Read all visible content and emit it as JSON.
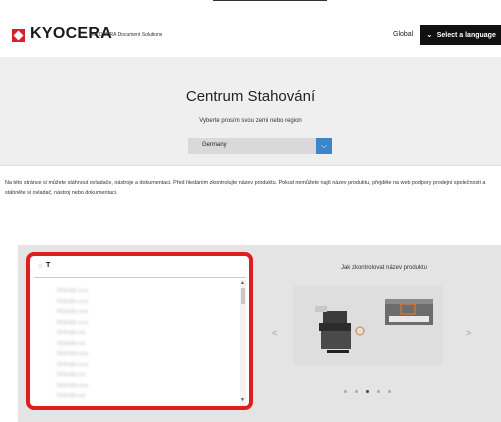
{
  "header": {
    "logo_text": "KYOCERA",
    "logo_subtitle": "KYOCERA Document Solutions",
    "global_label": "Global",
    "language_button": "Select a language"
  },
  "hero": {
    "title": "Centrum Stahování",
    "subtitle": "Vyberte prosím svou zemi nebo region",
    "country_value": "Germany"
  },
  "intro": {
    "text": "Na této stránce si můžete stáhnout ovladače, nástroje a dokumentaci. Před hledáním zkontrolujte název produktu. Pokud nemůžete najít název produktu, přejděte na web podpory prodejní společnosti a stáhněte si ovladač, nástroj nebo dokumentaci."
  },
  "search": {
    "value": "T",
    "results": [
      "TASKalfa xxxx",
      "TASKalfa xxxx",
      "TASKalfa xxxx",
      "TASKalfa xxxx",
      "TASKalfa xxx",
      "TASKalfa xxx",
      "TASKalfa xxxx",
      "TASKalfa xxxx",
      "TASKalfa xxx",
      "TASKalfa xxxx",
      "TASKalfa xxx"
    ]
  },
  "carousel": {
    "title": "Jak zkontrolovat název produktu",
    "prev": "<",
    "next": ">",
    "dot_count": 5,
    "active_dot": 2
  },
  "colors": {
    "brand_red": "#d6202a",
    "highlight_red": "#e01e1e",
    "dropdown_blue": "#3a86c8"
  }
}
